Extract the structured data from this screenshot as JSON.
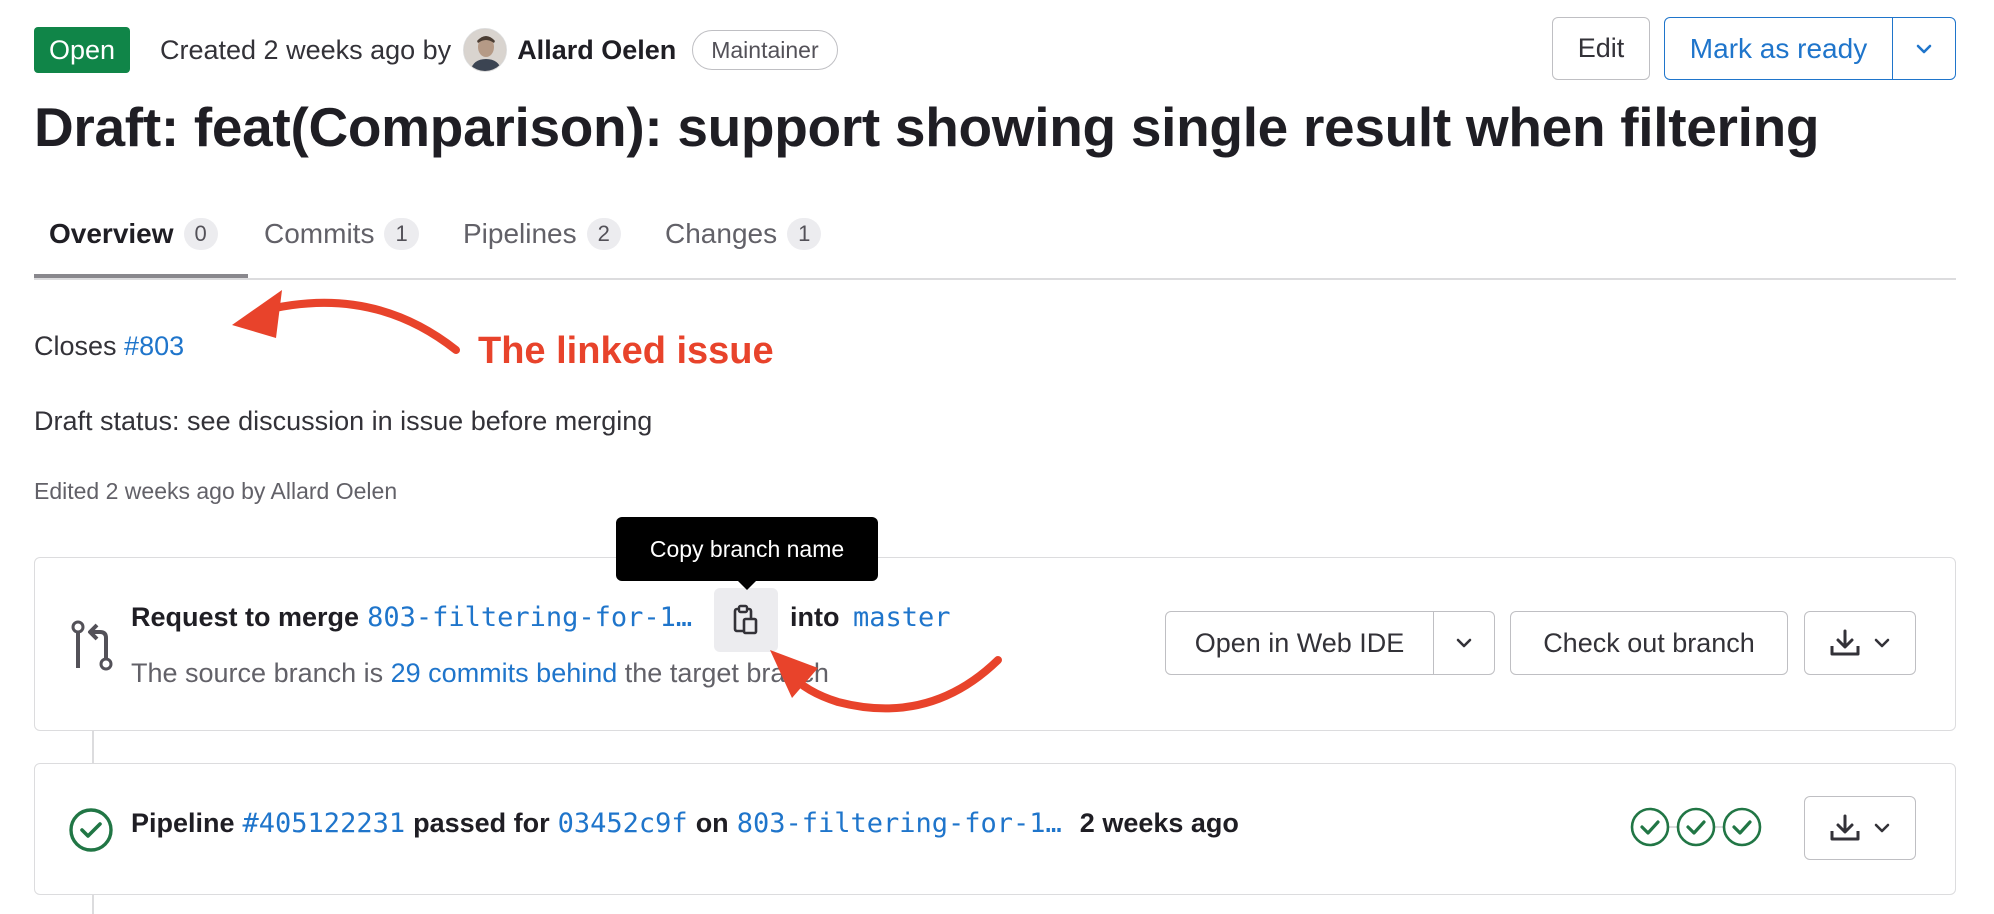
{
  "header": {
    "status": "Open",
    "created_text": "Created 2 weeks ago by",
    "author": "Allard Oelen",
    "role": "Maintainer",
    "edit_label": "Edit",
    "mark_ready_label": "Mark as ready"
  },
  "title": "Draft: feat(Comparison): support showing single result when filtering",
  "tabs": [
    {
      "label": "Overview",
      "count": "0"
    },
    {
      "label": "Commits",
      "count": "1"
    },
    {
      "label": "Pipelines",
      "count": "2"
    },
    {
      "label": "Changes",
      "count": "1"
    }
  ],
  "description": {
    "closes_label": "Closes",
    "issue_ref": "#803",
    "draft_status": "Draft status: see discussion in issue before merging",
    "edited": "Edited 2 weeks ago by Allard Oelen"
  },
  "annotation": {
    "linked_issue": "The linked issue"
  },
  "merge": {
    "request_label": "Request to merge",
    "source_branch": "803-filtering-for-1…",
    "into_label": "into",
    "target_branch": "master",
    "tooltip": "Copy branch name",
    "behind_prefix": "The source branch is",
    "behind_link": "29 commits behind",
    "behind_suffix": "the target branch",
    "web_ide_label": "Open in Web IDE",
    "checkout_label": "Check out branch"
  },
  "pipeline": {
    "label": "Pipeline",
    "id": "#405122231",
    "passed_for": "passed for",
    "commit": "03452c9f",
    "on_label": "on",
    "branch": "803-filtering-for-1…",
    "time": "2 weeks ago",
    "stages": [
      "passed",
      "passed",
      "passed"
    ]
  },
  "colors": {
    "open_green": "#108548",
    "link_blue": "#1f75cb",
    "annotation_red": "#e8432b",
    "success_green": "#217645"
  }
}
